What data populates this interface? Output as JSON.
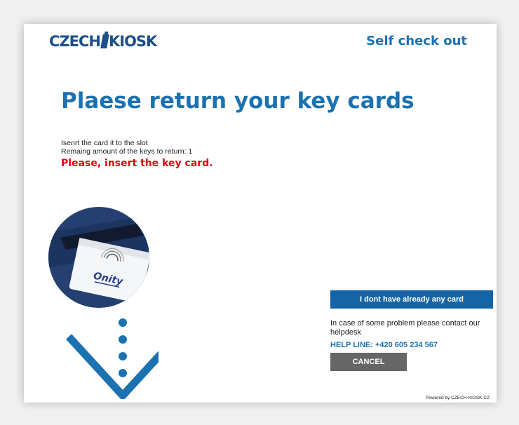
{
  "brand": {
    "logo_left": "CZECH",
    "logo_right": "KIOSK"
  },
  "header": {
    "title": "Self check out"
  },
  "main": {
    "headline": "Plaese return your key cards",
    "instruction_line1": "Isenrt the card it to the slot",
    "instruction_line2": "Remaing amount of the keys to return: 1",
    "warning": "Please, insert the key card.",
    "card_brand": "Onity"
  },
  "actions": {
    "no_card_label": "I dont have already any card",
    "help_text": "In case of some problem please contact our helpdesk",
    "help_line": "HELP LINE: +420 605 234 567",
    "cancel_label": "CANCEL"
  },
  "footer": {
    "powered_by": "Powered by CZECH-KIOSK.CZ"
  },
  "colors": {
    "brand_blue": "#1d4f8a",
    "accent_blue": "#1b72b0",
    "button_blue": "#1565a6",
    "warning_red": "#e3000f",
    "cancel_gray": "#666666"
  },
  "icons": {
    "card_reader": "card-insert-illustration",
    "arrow": "down-arrow-icon"
  }
}
